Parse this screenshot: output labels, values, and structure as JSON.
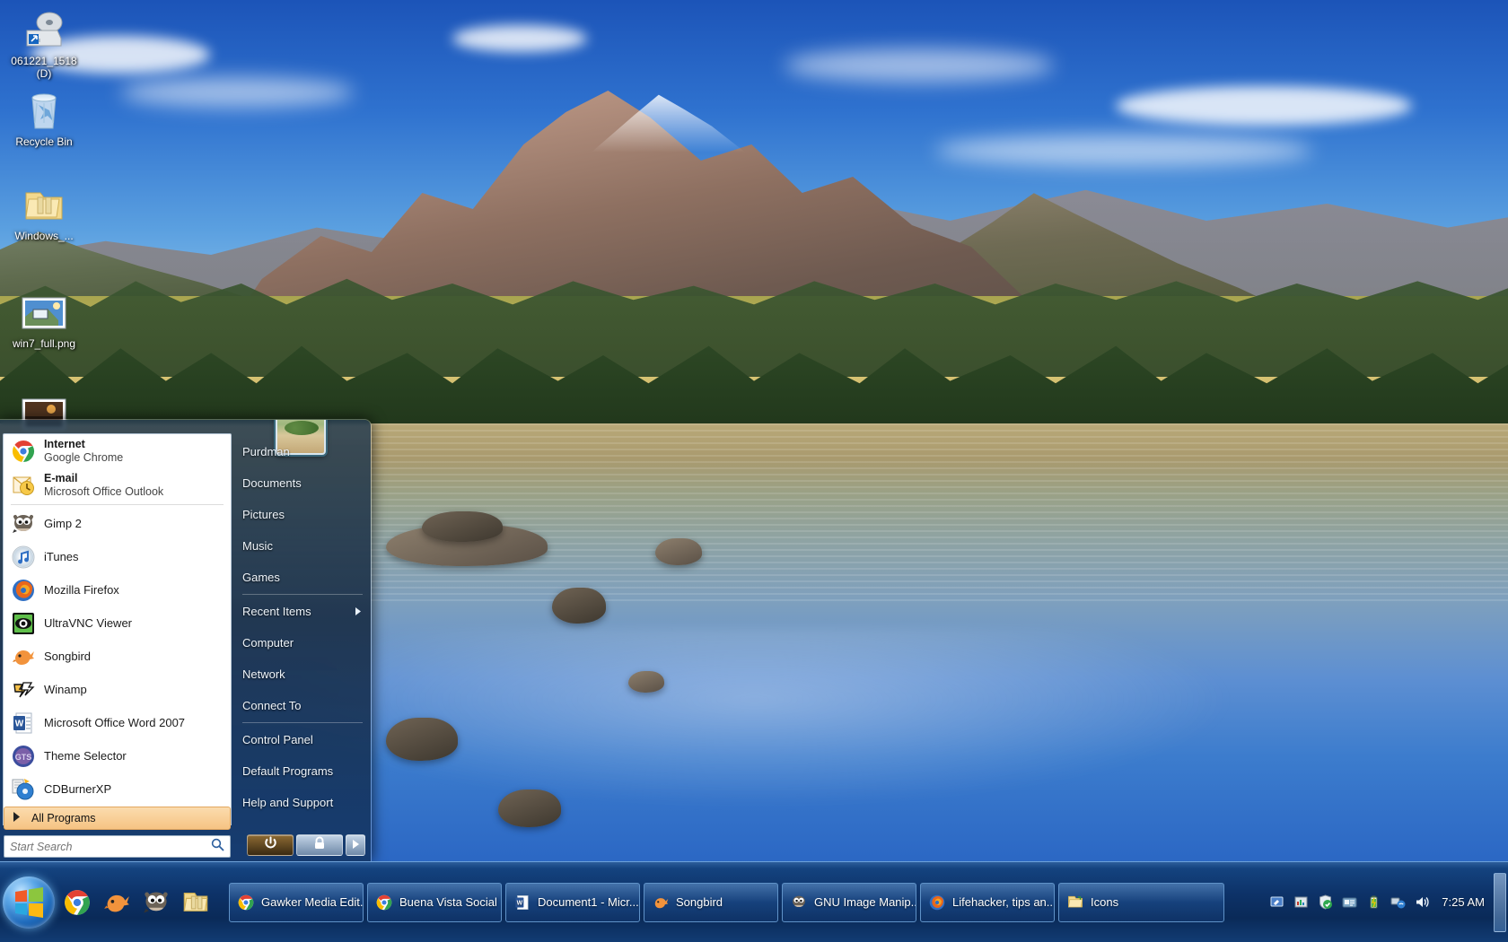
{
  "desktop": {
    "icons": [
      {
        "label": "061221_1518 (D)",
        "icon": "cd-drive-icon"
      },
      {
        "label": "Recycle Bin",
        "icon": "recycle-bin-icon"
      },
      {
        "label": "Windows_...",
        "icon": "folder-icon"
      },
      {
        "label": "win7_full.png",
        "icon": "image-file-icon"
      },
      {
        "label": "",
        "icon": "image-file-icon"
      }
    ]
  },
  "start_menu": {
    "user_name": "Purdman",
    "left_header": [
      {
        "title": "Internet",
        "subtitle": "Google Chrome",
        "icon": "chrome-icon"
      },
      {
        "title": "E-mail",
        "subtitle": "Microsoft Office Outlook",
        "icon": "outlook-icon"
      }
    ],
    "programs": [
      {
        "label": "Gimp 2",
        "icon": "gimp-icon"
      },
      {
        "label": "iTunes",
        "icon": "itunes-icon"
      },
      {
        "label": "Mozilla Firefox",
        "icon": "firefox-icon"
      },
      {
        "label": "UltraVNC Viewer",
        "icon": "ultravnc-icon"
      },
      {
        "label": "Songbird",
        "icon": "songbird-icon"
      },
      {
        "label": "Winamp",
        "icon": "winamp-icon"
      },
      {
        "label": "Microsoft Office Word 2007",
        "icon": "word-icon"
      },
      {
        "label": "Theme Selector",
        "icon": "theme-selector-icon"
      },
      {
        "label": "CDBurnerXP",
        "icon": "cdburnerxp-icon"
      }
    ],
    "all_programs_label": "All Programs",
    "search_placeholder": "Start Search",
    "search_value": "",
    "right_items": [
      {
        "label": "Purdman",
        "submenu": false
      },
      {
        "label": "Documents",
        "submenu": false
      },
      {
        "label": "Pictures",
        "submenu": false
      },
      {
        "label": "Music",
        "submenu": false
      },
      {
        "label": "Games",
        "submenu": false,
        "separator_after": true
      },
      {
        "label": "Recent Items",
        "submenu": true
      },
      {
        "label": "Computer",
        "submenu": false
      },
      {
        "label": "Network",
        "submenu": false
      },
      {
        "label": "Connect To",
        "submenu": false,
        "separator_after": true
      },
      {
        "label": "Control Panel",
        "submenu": false
      },
      {
        "label": "Default Programs",
        "submenu": false
      },
      {
        "label": "Help and Support",
        "submenu": false
      }
    ],
    "power_buttons": [
      {
        "name": "shut-down",
        "icon": "power-icon"
      },
      {
        "name": "lock",
        "icon": "lock-icon"
      },
      {
        "name": "more-options",
        "icon": "chevron-right-icon"
      }
    ]
  },
  "taskbar": {
    "start_button_label": "Start",
    "quick_launch": [
      {
        "label": "Google Chrome",
        "icon": "chrome-icon"
      },
      {
        "label": "Songbird",
        "icon": "songbird-icon"
      },
      {
        "label": "GIMP",
        "icon": "gimp-icon"
      },
      {
        "label": "Windows Explorer",
        "icon": "explorer-folder-icon"
      }
    ],
    "tasks": [
      {
        "label": "Gawker Media Edit...",
        "icon": "chrome-icon"
      },
      {
        "label": "Buena Vista Social ...",
        "icon": "chrome-icon"
      },
      {
        "label": "Document1 - Micr...",
        "icon": "word-icon"
      },
      {
        "label": "Songbird",
        "icon": "songbird-icon"
      },
      {
        "label": "GNU Image Manip...",
        "icon": "gimp-icon"
      },
      {
        "label": "Lifehacker, tips an...",
        "icon": "firefox-icon"
      },
      {
        "label": "Icons",
        "icon": "explorer-folder-icon"
      }
    ],
    "tray_icons": [
      {
        "name": "tablet-input-icon"
      },
      {
        "name": "equalizer-icon"
      },
      {
        "name": "security-shield-icon"
      },
      {
        "name": "messenger-icon"
      },
      {
        "name": "battery-icon"
      },
      {
        "name": "network-icon"
      },
      {
        "name": "volume-icon"
      }
    ],
    "clock": "7:25 AM"
  },
  "colors": {
    "taskbar_blue": "#0d3268",
    "start_highlight": "#f6c483",
    "accent": "#5ba7e8"
  }
}
